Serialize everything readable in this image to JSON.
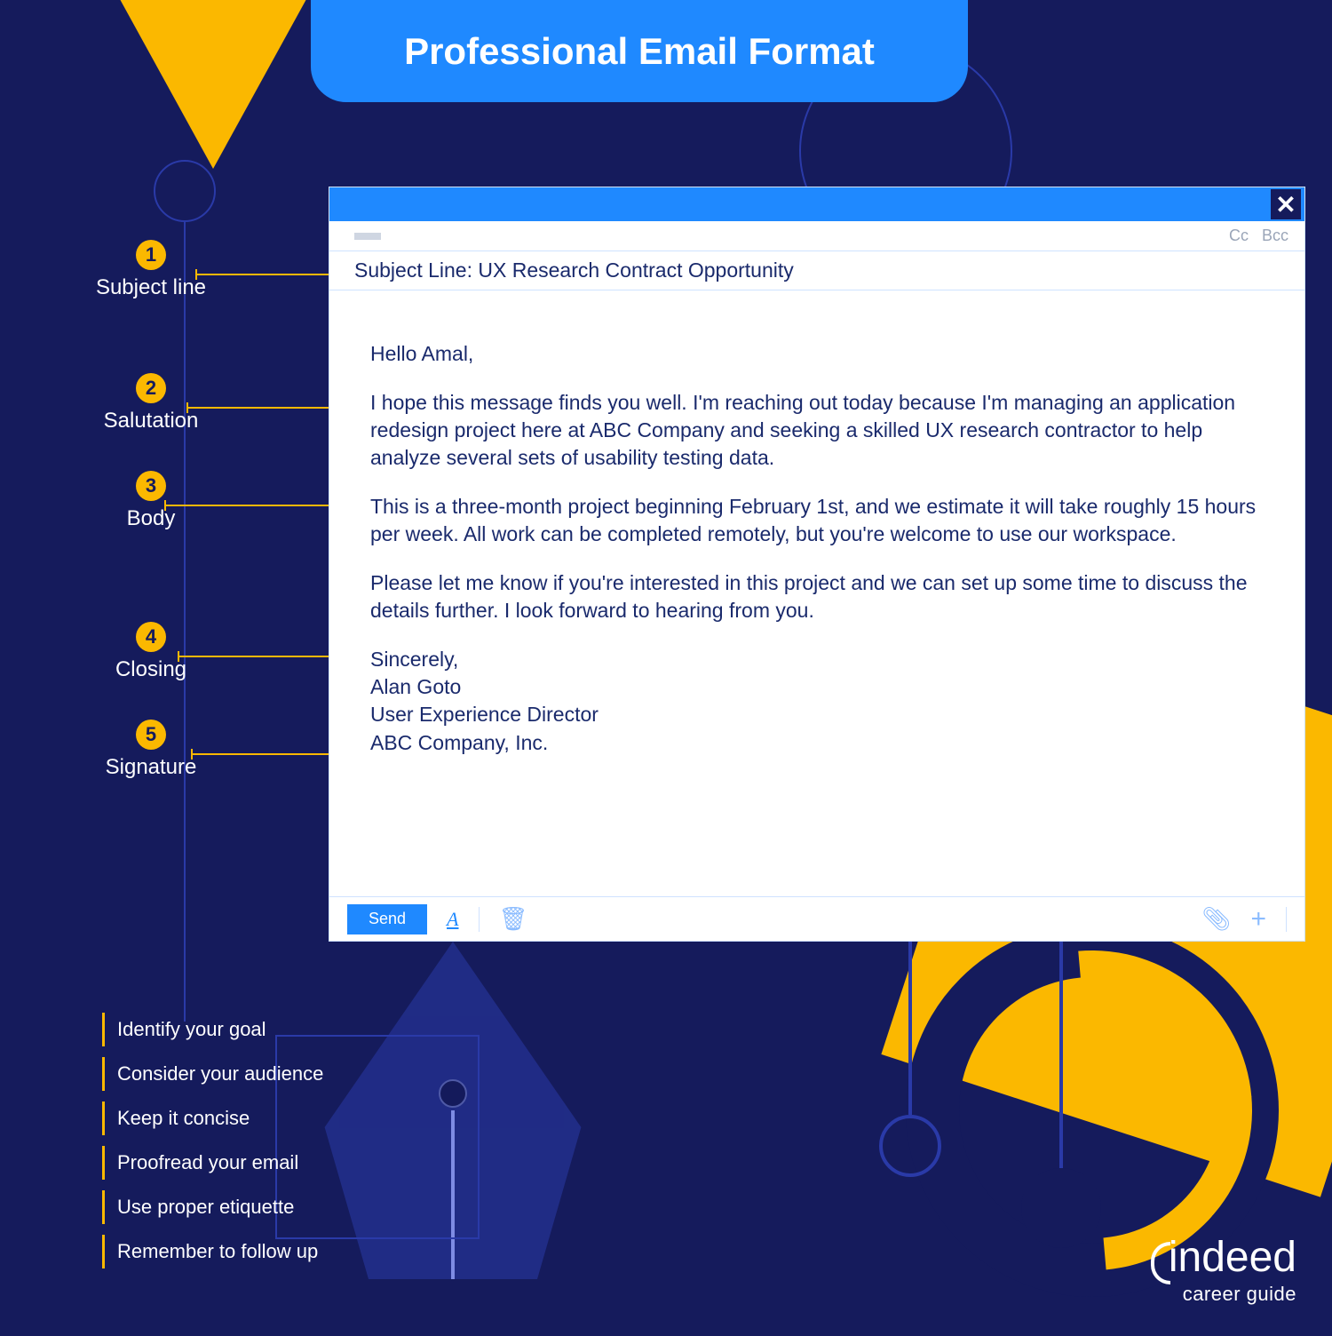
{
  "title": "Professional Email Format",
  "callouts": [
    {
      "num": "1",
      "label": "Subject line"
    },
    {
      "num": "2",
      "label": "Salutation"
    },
    {
      "num": "3",
      "label": "Body"
    },
    {
      "num": "4",
      "label": "Closing"
    },
    {
      "num": "5",
      "label": "Signature"
    }
  ],
  "tips": [
    "Identify your goal",
    "Consider your audience",
    "Keep it concise",
    "Proofread your email",
    "Use proper etiquette",
    "Remember to follow up"
  ],
  "email": {
    "cc_label": "Cc",
    "bcc_label": "Bcc",
    "subject": "Subject Line: UX Research Contract Opportunity",
    "salutation": "Hello Amal,",
    "paragraphs": [
      "I hope this message finds you well. I'm reaching out today because I'm managing an application redesign project here at ABC Company and seeking a skilled UX research contractor to help analyze several sets of usability testing data.",
      "This is a three-month project beginning February 1st, and we estimate it will take roughly 15 hours per week. All work can be completed remotely, but you're welcome to use our workspace.",
      "Please let me know if you're interested in this project and we can set up some time to discuss the details further. I look forward to hearing from you."
    ],
    "closing": "Sincerely,",
    "signature": {
      "name": "Alan Goto",
      "title": "User Experience Director",
      "company": "ABC Company, Inc."
    },
    "send_label": "Send"
  },
  "brand": {
    "name": "indeed",
    "sub": "career guide"
  }
}
